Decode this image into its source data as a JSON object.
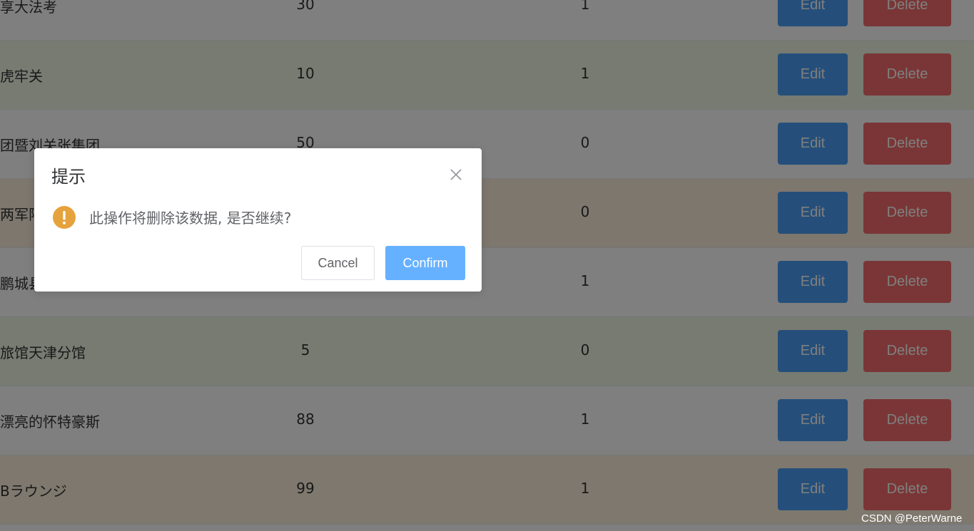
{
  "table": {
    "rows": [
      {
        "name": "享大法考",
        "num": "30",
        "flag": "1"
      },
      {
        "name": " 虎牢关",
        "num": "10",
        "flag": "1"
      },
      {
        "name": "团暨刘关张集团",
        "num": "50",
        "flag": "0"
      },
      {
        "name": "两军阵",
        "num": "",
        "flag": "0"
      },
      {
        "name": "鹏城县",
        "num": "",
        "flag": "1"
      },
      {
        "name": "旅馆天津分馆",
        "num": "5",
        "flag": "0"
      },
      {
        "name": "漂亮的怀特豪斯",
        "num": "88",
        "flag": "1"
      },
      {
        "name": "Bラウンジ",
        "num": "99",
        "flag": "1"
      }
    ],
    "edit_label": "Edit",
    "delete_label": "Delete"
  },
  "dialog": {
    "title": "提示",
    "message": "此操作将删除该数据, 是否继续?",
    "cancel_label": "Cancel",
    "confirm_label": "Confirm",
    "close_icon": "close-icon",
    "warning_icon": "warning-icon"
  },
  "watermark": "CSDN @PeterWarne",
  "colors": {
    "edit": "#4a9ff5",
    "delete": "#f56c6c",
    "confirm": "#66b1ff",
    "warning": "#e6a23c"
  }
}
